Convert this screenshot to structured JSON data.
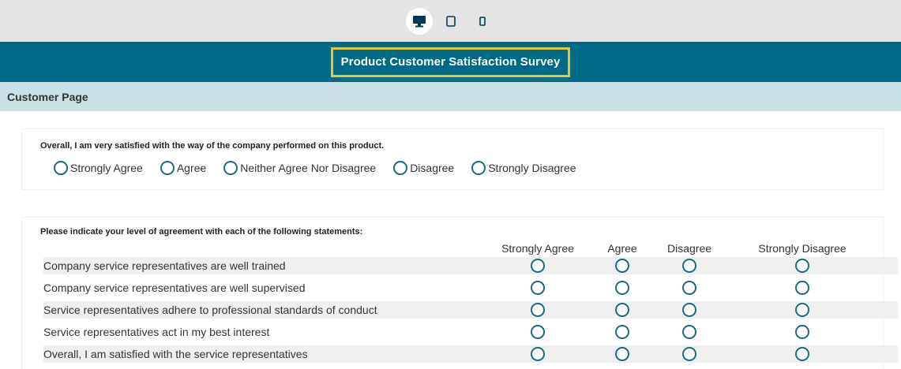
{
  "device_bar": {
    "buttons": [
      {
        "name": "desktop",
        "icon": "desktop-icon",
        "active": true
      },
      {
        "name": "tablet",
        "icon": "tablet-icon",
        "active": false
      },
      {
        "name": "phone",
        "icon": "phone-icon",
        "active": false
      }
    ]
  },
  "header": {
    "title": "Product Customer Satisfaction Survey"
  },
  "page": {
    "title": "Customer Page"
  },
  "question1": {
    "text": "Overall, I am very satisfied with the way of the company performed on this product.",
    "options": [
      "Strongly Agree",
      "Agree",
      "Neither Agree Nor Disagree",
      "Disagree",
      "Strongly Disagree"
    ]
  },
  "question2": {
    "text": "Please indicate your level of agreement with each of the following statements:",
    "columns": [
      "Strongly Agree",
      "Agree",
      "Disagree",
      "Strongly Disagree"
    ],
    "rows": [
      "Company service representatives are well trained",
      "Company service representatives are well supervised",
      "Service representatives adhere to professional standards of conduct",
      "Service representatives act in my best interest",
      "Overall, I am satisfied with the service representatives"
    ]
  },
  "colors": {
    "header_bg": "#006b86",
    "title_border": "#e9c53a",
    "page_bar_bg": "#cbe1e8",
    "radio_border": "#1b6a80"
  }
}
